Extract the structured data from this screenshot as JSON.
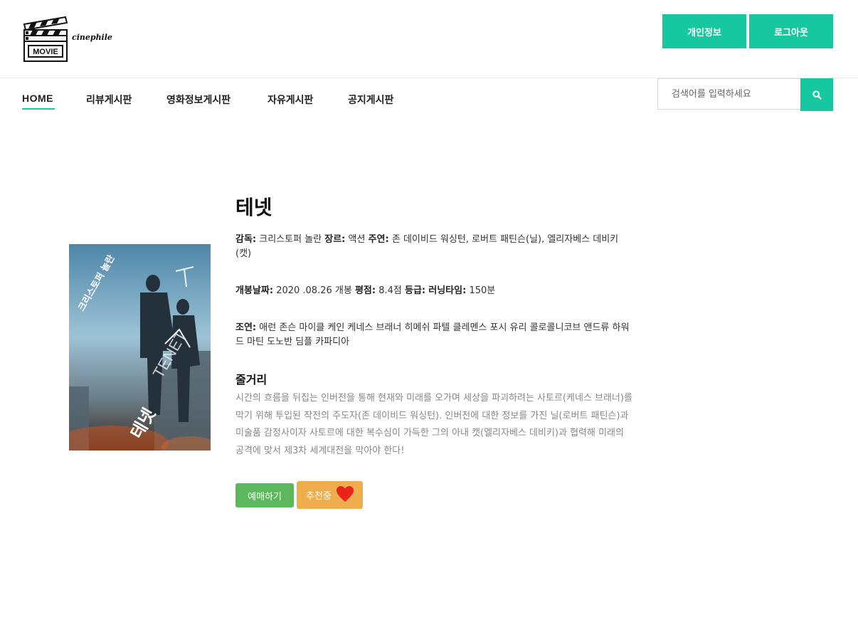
{
  "header": {
    "logo_text": "cinephile",
    "logo_board_text": "MOVIE",
    "profile_label": "개인정보",
    "logout_label": "로그아웃"
  },
  "nav": {
    "items": [
      {
        "label": "HOME",
        "active": true
      },
      {
        "label": "리뷰게시판"
      },
      {
        "label": "영화정보게시판"
      },
      {
        "label": "자유게시판"
      },
      {
        "label": "공지게시판"
      }
    ]
  },
  "search": {
    "placeholder": "검색어를 입력하세요",
    "icon": "search-icon"
  },
  "movie": {
    "title": "테넷",
    "director_label": "감독:",
    "director": "크리스토퍼 놀란",
    "genre_label": "장르:",
    "genre": "액션",
    "cast_label": "주연:",
    "cast": "존 데이비드 워싱턴, 로버트 패틴슨(닐), 엘리자베스 데비키(캣)",
    "release_label": "개봉날짜:",
    "release": "2020 .08.26 개봉",
    "rating_label": "평점:",
    "rating": "8.4점",
    "grade_label": "등급:",
    "grade": "",
    "runtime_label": "러닝타임:",
    "runtime": "150분",
    "supporting_label": "조연:",
    "supporting": "애런 존슨 마이클 케인 케네스 브래너 히메쉬 파텔 클레멘스 포시 유리 콜로콜니코브 앤드류 하워드 마틴 도노반 딤플 카파디아",
    "plot_title": "줄거리",
    "plot": "시간의 흐름을 뒤집는 인버전을 통해 현재와 미래를 오가며 세상을 파괴하려는 사토르(케네스 브래너)를 막기 위해 투입된 작전의 주도자(존 데이비드 워싱턴). 인버전에 대한 정보를 가진 닐(로버트 패틴슨)과 미술품 감정사이자 사토르에 대한 복수심이 가득한 그의 아내 캣(엘리자베스 데비키)과 협력해 미래의 공격에 맞서 제3차 세계대전을 막아야 한다!"
  },
  "poster": {
    "title_text": "테넷",
    "tenet_text": "TENET",
    "small_text": "크리스토퍼 놀란"
  },
  "actions": {
    "book_label": "예매하기",
    "recommend_label": "추천중"
  },
  "colors": {
    "accent": "#17c79f",
    "book_button": "#5cb85c",
    "recommend_button": "#f0ad4e",
    "heart": "#e8231a"
  }
}
